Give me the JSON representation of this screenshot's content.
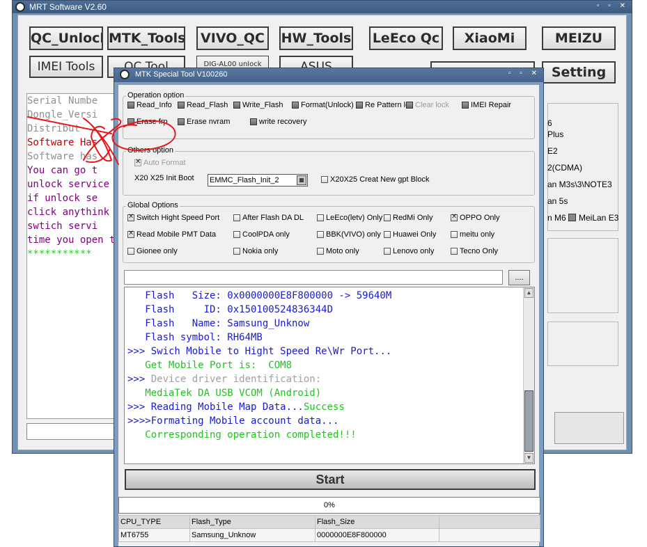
{
  "main_window": {
    "title": "MRT Software V2.60",
    "buttons": {
      "qc_unlock": "QC_Unlock",
      "mtk_tools": "MTK_Tools",
      "vivo_qc": "VIVO_QC",
      "hw_tools": "HW_Tools",
      "leeco_qc": "LeEco Qc",
      "xiaomi": "XiaoMi",
      "meizu": "MEIZU",
      "imei_tools": "IMEI Tools",
      "qc_tool": "QC Tool",
      "dig_unlock": "DIG-AL00 unlock",
      "asus": "ASUS",
      "setting": "Setting"
    },
    "log_lines": [
      {
        "text": "  Serial Numbe",
        "color": "#909090"
      },
      {
        "text": "  Dongle_Versi",
        "color": "#909090"
      },
      {
        "text": "  Distribut",
        "color": "#909090"
      },
      {
        "text": "  Software Has",
        "color": "#c00000"
      },
      {
        "text": "  Software has",
        "color": "#909090"
      },
      {
        "text": "  You can go t",
        "color": "#800080"
      },
      {
        "text": "unlock service",
        "color": "#800080"
      },
      {
        "text": "  if unlock se",
        "color": "#800080"
      },
      {
        "text": "click anythink n",
        "color": "#800080"
      },
      {
        "text": "  swtich servi",
        "color": "#800080"
      },
      {
        "text": "time you open th",
        "color": "#800080"
      },
      {
        "text": "  ***********",
        "color": "#22cc22"
      }
    ],
    "right_fragments": [
      "6",
      "Plus",
      "E2",
      "2(CDMA)",
      "an M3s\\3\\NOTE3",
      "an 5s",
      "n M6",
      "MeiLan E3"
    ]
  },
  "dialog": {
    "title": "MTK Special Tool V100260",
    "operation_option": {
      "label": "Operation option",
      "items": [
        {
          "label": "Read_Info",
          "checked": false,
          "disabled": false
        },
        {
          "label": "Read_Flash",
          "checked": false,
          "disabled": false
        },
        {
          "label": "Write_Flash",
          "checked": false,
          "disabled": false
        },
        {
          "label": "Format(Unlock)",
          "checked": false,
          "disabled": false
        },
        {
          "label": "Re Pattern lo",
          "checked": false,
          "disabled": false
        },
        {
          "label": "Clear lock",
          "checked": false,
          "disabled": true
        },
        {
          "label": "IMEI Repair",
          "checked": false,
          "disabled": false
        },
        {
          "label": "Erase frp",
          "checked": false,
          "disabled": false
        },
        {
          "label": "Erase nvram",
          "checked": false,
          "disabled": false
        },
        {
          "label": "write recovery",
          "checked": false,
          "disabled": false
        }
      ]
    },
    "others_option": {
      "label": "Others option",
      "auto_format": "Auto Format",
      "init_boot_label": "X20 X25 Init Boot",
      "init_boot_value": "EMMC_Flash_Init_2",
      "gpt_label": "X20X25 Creat New gpt Block"
    },
    "global_options": {
      "label": "Global Options",
      "items": [
        {
          "label": "Switch Hight Speed Port",
          "checked": true
        },
        {
          "label": "After Flash DA DL",
          "checked": false
        },
        {
          "label": "LeEco(letv) Only",
          "checked": false
        },
        {
          "label": "RedMi Only",
          "checked": false
        },
        {
          "label": "OPPO Only",
          "checked": true
        },
        {
          "label": "Read Mobile PMT Data",
          "checked": true
        },
        {
          "label": "CoolPDA only",
          "checked": false
        },
        {
          "label": "BBK(VIVO) only",
          "checked": false
        },
        {
          "label": "Huawei Only",
          "checked": false
        },
        {
          "label": "meitu only",
          "checked": false
        },
        {
          "label": "Gionee only",
          "checked": false
        },
        {
          "label": "Nokia only",
          "checked": false
        },
        {
          "label": "Moto only",
          "checked": false
        },
        {
          "label": "Lenovo only",
          "checked": false
        },
        {
          "label": "Tecno Only",
          "checked": false
        }
      ]
    },
    "browse_label": "....",
    "console_lines": [
      {
        "prefix": "",
        "text": "   Flash   Size: 0x0000000E8F800000 -> 59640M",
        "suffix": "",
        "color": "#1a1ad0"
      },
      {
        "prefix": "",
        "text": "   Flash     ID: 0x150100524836344D",
        "suffix": "",
        "color": "#1a1ad0"
      },
      {
        "prefix": "",
        "text": "   Flash   Name: Samsung_Unknow",
        "suffix": "",
        "color": "#1a1ad0"
      },
      {
        "prefix": "",
        "text": "   Flash symbol: RH64MB",
        "suffix": "",
        "color": "#1a1ad0"
      },
      {
        "prefix": ">>> ",
        "text": "Swich Mobile to Hight Speed Re\\Wr Port...",
        "suffix": "",
        "color": "#1a1ad0"
      },
      {
        "prefix": "",
        "text": "   Get Mobile Port is:  COM8",
        "suffix": "",
        "color": "#1fc41f"
      },
      {
        "prefix": ">>> ",
        "text": "Device driver identification:",
        "suffix": "",
        "color": "#a0a0a0"
      },
      {
        "prefix": "",
        "text": "   MediaTek DA USB VCOM (Android)",
        "suffix": "",
        "color": "#1fc41f"
      },
      {
        "prefix": ">>> ",
        "text": "Reading Mobile Map Data...",
        "suffix": "Success",
        "color": "#1a1ad0"
      },
      {
        "prefix": ">>>>",
        "text": "Formating Mobile account data...",
        "suffix": "",
        "color": "#1a1ad0"
      },
      {
        "prefix": "",
        "text": "   Corresponding operation completed!!!",
        "suffix": "",
        "color": "#1fc41f"
      }
    ],
    "start_label": "Start",
    "progress_percent": 0,
    "progress_text": "0%",
    "info_table": {
      "headers": [
        "CPU_TYPE",
        "Flash_Type",
        "Flash_Size",
        ""
      ],
      "row": [
        "MT6755",
        "Samsung_Unknow",
        "0000000E8F800000",
        ""
      ]
    }
  },
  "colors": {
    "annotation": "#e8161a",
    "console_blue": "#1a1ad0",
    "console_green": "#1fc41f"
  }
}
